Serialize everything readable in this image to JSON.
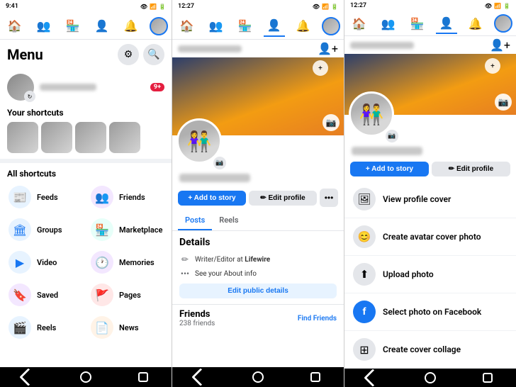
{
  "panels": {
    "left": {
      "status_time": "9:41",
      "title": "Menu",
      "settings_icon": "⚙",
      "search_icon": "🔍",
      "shortcuts_label": "Your shortcuts",
      "all_shortcuts_label": "All shortcuts",
      "menu_items": [
        {
          "id": "feeds",
          "label": "Feeds",
          "icon": "📰",
          "icon_class": "icon-blue"
        },
        {
          "id": "friends",
          "label": "Friends",
          "icon": "👥",
          "icon_class": "icon-purple"
        },
        {
          "id": "groups",
          "label": "Groups",
          "icon": "🏛",
          "icon_class": "icon-blue"
        },
        {
          "id": "marketplace",
          "label": "Marketplace",
          "icon": "🏪",
          "icon_class": "icon-teal"
        },
        {
          "id": "video",
          "label": "Video",
          "icon": "▶",
          "icon_class": "icon-blue"
        },
        {
          "id": "memories",
          "label": "Memories",
          "icon": "🕐",
          "icon_class": "icon-purple"
        },
        {
          "id": "saved",
          "label": "Saved",
          "icon": "🔖",
          "icon_class": "icon-purple"
        },
        {
          "id": "pages",
          "label": "Pages",
          "icon": "🚩",
          "icon_class": "icon-red"
        },
        {
          "id": "reels",
          "label": "Reels",
          "icon": "🎬",
          "icon_class": "icon-blue"
        },
        {
          "id": "news",
          "label": "News",
          "icon": "📄",
          "icon_class": "icon-orange"
        }
      ]
    },
    "center": {
      "status_time": "12:27",
      "profile_name_placeholder": "User Name",
      "add_story_label": "+ Add to story",
      "edit_profile_label": "✏ Edit profile",
      "more_label": "•••",
      "tabs": [
        {
          "id": "posts",
          "label": "Posts",
          "active": true
        },
        {
          "id": "reels",
          "label": "Reels",
          "active": false
        }
      ],
      "details_section_title": "Details",
      "detail_items": [
        {
          "icon": "✏",
          "text": "Writer/Editor at Lifewire"
        },
        {
          "icon": "•••",
          "text": "See your About info"
        }
      ],
      "edit_public_label": "Edit public details",
      "friends_label": "Friends",
      "friends_count": "238 friends",
      "find_friends_label": "Find Friends"
    },
    "right": {
      "status_time": "12:27",
      "add_story_label": "+ Add to story",
      "edit_profile_label": "✏ Edit profile",
      "dropdown_items": [
        {
          "id": "view-profile-cover",
          "icon": "🖼",
          "label": "View profile cover"
        },
        {
          "id": "create-avatar-cover",
          "icon": "😊",
          "label": "Create avatar cover photo"
        },
        {
          "id": "upload-photo",
          "icon": "⬆",
          "label": "Upload photo"
        },
        {
          "id": "select-photo-facebook",
          "icon": "🔵",
          "label": "Select photo on Facebook"
        },
        {
          "id": "create-cover-collage",
          "icon": "⊞",
          "label": "Create cover collage"
        }
      ]
    }
  },
  "bottom_nav": {
    "back_label": "back",
    "home_label": "home",
    "recents_label": "recents"
  }
}
